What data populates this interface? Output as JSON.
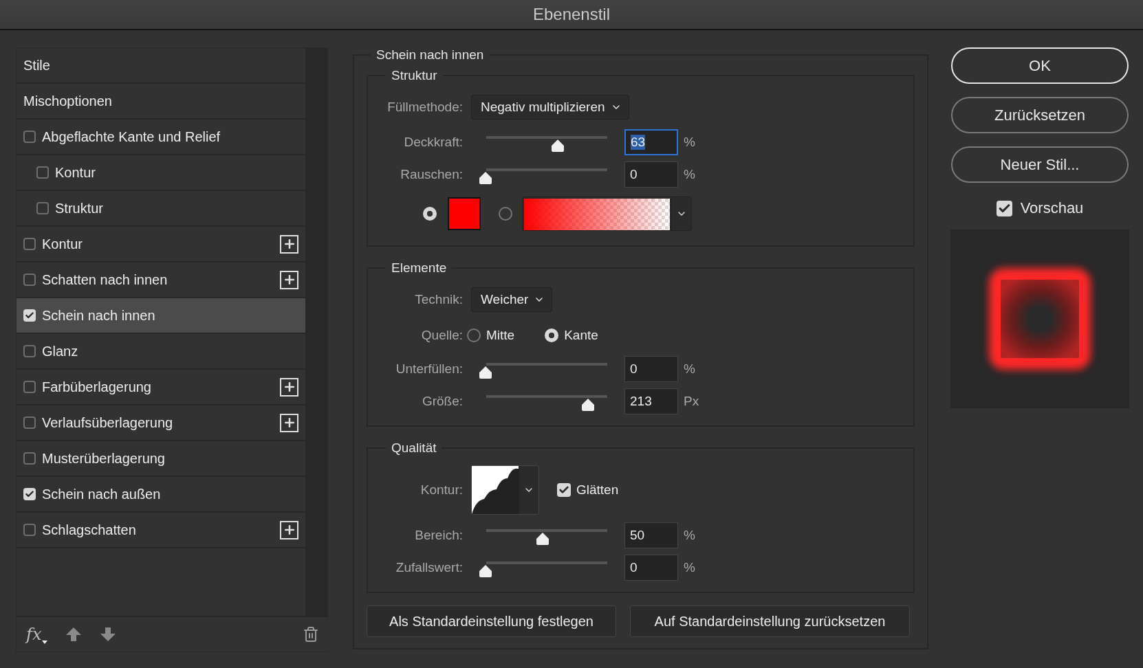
{
  "window": {
    "title": "Ebenenstil"
  },
  "styles_list": {
    "items": [
      {
        "label": "Stile",
        "kind": "header",
        "selected": false
      },
      {
        "label": "Mischoptionen",
        "kind": "header",
        "selected": false
      },
      {
        "label": "Abgeflachte Kante und Relief",
        "kind": "checkbox",
        "checked": false,
        "selected": false,
        "addable": false,
        "children": [
          {
            "label": "Kontur",
            "kind": "checkbox",
            "checked": false,
            "selected": false,
            "addable": false
          },
          {
            "label": "Struktur",
            "kind": "checkbox",
            "checked": false,
            "selected": false,
            "addable": false
          }
        ]
      },
      {
        "label": "Kontur",
        "kind": "checkbox",
        "checked": false,
        "selected": false,
        "addable": true
      },
      {
        "label": "Schatten nach innen",
        "kind": "checkbox",
        "checked": false,
        "selected": false,
        "addable": true
      },
      {
        "label": "Schein nach innen",
        "kind": "checkbox",
        "checked": true,
        "selected": true,
        "addable": false
      },
      {
        "label": "Glanz",
        "kind": "checkbox",
        "checked": false,
        "selected": false,
        "addable": false
      },
      {
        "label": "Farbüberlagerung",
        "kind": "checkbox",
        "checked": false,
        "selected": false,
        "addable": true
      },
      {
        "label": "Verlaufsüberlagerung",
        "kind": "checkbox",
        "checked": false,
        "selected": false,
        "addable": true
      },
      {
        "label": "Musterüberlagerung",
        "kind": "checkbox",
        "checked": false,
        "selected": false,
        "addable": false
      },
      {
        "label": "Schein nach außen",
        "kind": "checkbox",
        "checked": true,
        "selected": false,
        "addable": false
      },
      {
        "label": "Schlagschatten",
        "kind": "checkbox",
        "checked": false,
        "selected": false,
        "addable": true
      }
    ],
    "footer": {
      "fx": "fx"
    }
  },
  "panel": {
    "title": "Schein nach innen",
    "sections": [
      {
        "title": "Struktur",
        "rows": [
          {
            "kind": "select",
            "label": "Füllmethode:",
            "value": "Negativ multiplizieren"
          },
          {
            "kind": "slider",
            "label": "Deckkraft:",
            "level": 0.63,
            "value": "63",
            "unit": "%",
            "focused": true
          },
          {
            "kind": "slider",
            "label": "Rauschen:",
            "level": 0,
            "value": "0",
            "unit": "%",
            "focused": false
          },
          {
            "kind": "colors",
            "options": [
              {
                "kind": "swatch",
                "selected": true,
                "color": "#ff0000"
              },
              {
                "kind": "gradient",
                "selected": false,
                "color": "#ff0000"
              }
            ]
          }
        ]
      },
      {
        "title": "Elemente",
        "rows": [
          {
            "kind": "select",
            "label": "Technik:",
            "value": "Weicher"
          },
          {
            "kind": "radio",
            "label": "Quelle:",
            "options": [
              {
                "label": "Mitte",
                "selected": false
              },
              {
                "label": "Kante",
                "selected": true
              }
            ]
          },
          {
            "kind": "slider",
            "label": "Unterfüllen:",
            "level": 0,
            "value": "0",
            "unit": "%",
            "focused": false
          },
          {
            "kind": "slider",
            "label": "Größe:",
            "level": 0.9,
            "value": "213",
            "unit": "Px",
            "focused": false
          }
        ]
      },
      {
        "title": "Qualität",
        "rows": [
          {
            "kind": "contour",
            "label": "Kontur:",
            "checkbox": {
              "label": "Glätten",
              "checked": true
            }
          },
          {
            "kind": "slider",
            "label": "Bereich:",
            "level": 0.5,
            "value": "50",
            "unit": "%",
            "focused": false
          },
          {
            "kind": "slider",
            "label": "Zufallswert:",
            "level": 0,
            "value": "0",
            "unit": "%",
            "focused": false
          }
        ]
      }
    ],
    "buttons": [
      "Als Standardeinstellung festlegen",
      "Auf Standardeinstellung zurücksetzen"
    ]
  },
  "actions": {
    "buttons": [
      {
        "label": "OK",
        "default": true
      },
      {
        "label": "Zurücksetzen",
        "default": false
      },
      {
        "label": "Neuer Stil...",
        "default": false
      }
    ],
    "preview": {
      "label": "Vorschau",
      "checked": true
    }
  }
}
